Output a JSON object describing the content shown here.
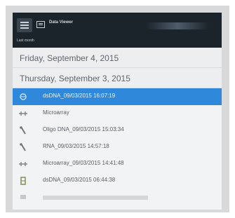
{
  "app": {
    "title": "Data Viewer",
    "section_label": "Last month"
  },
  "groups": [
    {
      "date": "Friday, September 4, 2015"
    },
    {
      "date": "Thursday, September 3, 2015"
    }
  ],
  "items": [
    {
      "label": "dsDNA_09/03/2015 16:07:19",
      "icon": "dna-icon",
      "selected": true
    },
    {
      "label": "Microarray",
      "icon": "microarray-icon",
      "selected": false
    },
    {
      "label": "Oligo DNA_09/03/2015 15:03:34",
      "icon": "oligo-icon",
      "selected": false
    },
    {
      "label": "RNA_09/03/2015 14:57:18",
      "icon": "rna-icon",
      "selected": false
    },
    {
      "label": "Microarray_09/03/2015 14:41:48",
      "icon": "microarray-icon",
      "selected": false
    },
    {
      "label": "dsDNA_09/03/2015 06:44:38",
      "icon": "dna-icon",
      "selected": false
    }
  ],
  "colors": {
    "titlebar": "#1b232b",
    "selection": "#2f88d9",
    "background": "#f2f3f4"
  }
}
